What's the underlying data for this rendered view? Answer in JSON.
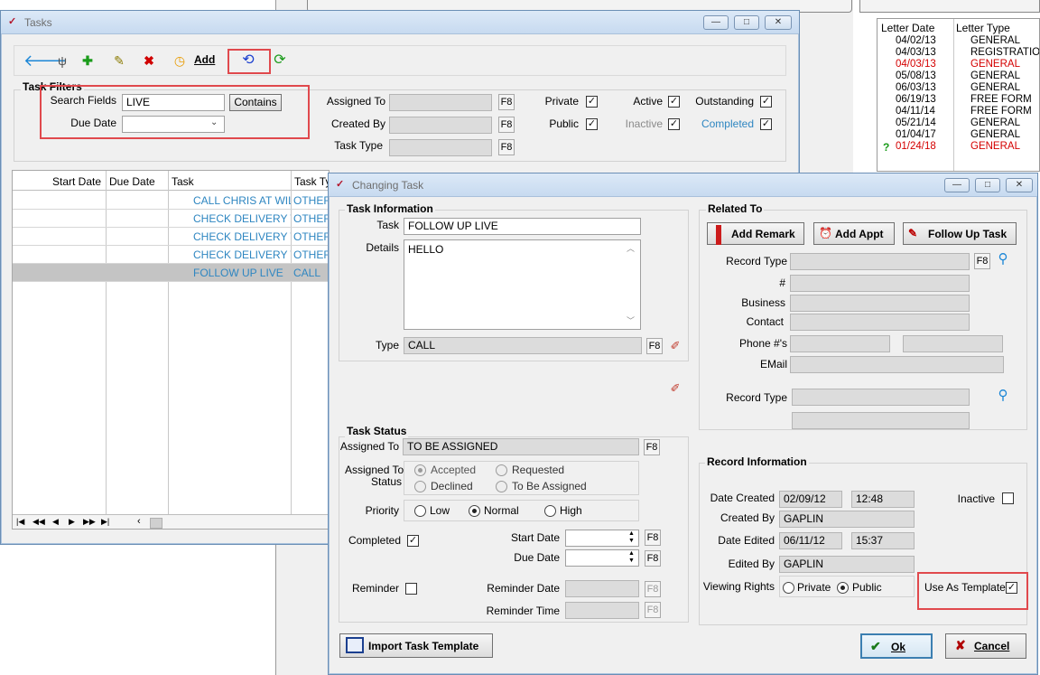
{
  "colors": {
    "accent": "#2e86c1",
    "highlight": "#e0494d",
    "overdue": "#d40000"
  },
  "bg": {
    "letter_headers": [
      "Letter Date",
      "Letter Type"
    ],
    "letters": [
      {
        "date": "04/02/13",
        "type": "GENERAL",
        "red": false
      },
      {
        "date": "04/03/13",
        "type": "REGISTRATION",
        "red": false
      },
      {
        "date": "04/03/13",
        "type": "GENERAL",
        "red": true
      },
      {
        "date": "05/08/13",
        "type": "GENERAL",
        "red": false
      },
      {
        "date": "06/03/13",
        "type": "GENERAL",
        "red": false
      },
      {
        "date": "06/19/13",
        "type": "FREE FORM",
        "red": false
      },
      {
        "date": "04/11/14",
        "type": "FREE FORM",
        "red": false
      },
      {
        "date": "05/21/14",
        "type": "GENERAL",
        "red": false
      },
      {
        "date": "01/04/17",
        "type": "GENERAL",
        "red": false
      },
      {
        "date": "01/24/18",
        "type": "GENERAL",
        "red": true
      }
    ]
  },
  "tasks": {
    "title": "Tasks",
    "toolbar": {
      "add_label": "Add"
    },
    "filters": {
      "group_title": "Task Filters",
      "search_fields_label": "Search Fields",
      "search_value": "LIVE",
      "contains_label": "Contains",
      "due_date_label": "Due Date",
      "assigned_to_label": "Assigned To",
      "created_by_label": "Created By",
      "task_type_label": "Task Type",
      "f8": "F8",
      "private_label": "Private",
      "public_label": "Public",
      "active_label": "Active",
      "inactive_label": "Inactive",
      "outstanding_label": "Outstanding",
      "completed_label": "Completed"
    },
    "grid": {
      "headers": [
        "Start Date",
        "Due Date",
        "Task",
        "Task Ty"
      ],
      "rows": [
        {
          "task": "CALL CHRIS AT WILL",
          "type": "OTHER"
        },
        {
          "task": "CHECK DELIVERY TI",
          "type": "OTHER"
        },
        {
          "task": "CHECK DELIVERY TI",
          "type": "OTHER"
        },
        {
          "task": "CHECK DELIVERY TI",
          "type": "OTHER"
        },
        {
          "task": "FOLLOW UP LIVE",
          "type": "CALL"
        }
      ]
    }
  },
  "changing": {
    "title": "Changing Task",
    "task_info": {
      "group_title": "Task Information",
      "task_label": "Task",
      "task_value": "FOLLOW UP LIVE",
      "details_label": "Details",
      "details_value": "HELLO",
      "type_label": "Type",
      "type_value": "CALL",
      "f8": "F8"
    },
    "status": {
      "group_title": "Task Status",
      "assigned_to_label": "Assigned To",
      "assigned_to_value": "TO BE ASSIGNED",
      "f8": "F8",
      "assigned_status_label_1": "Assigned To",
      "assigned_status_label_2": "Status",
      "accepted": "Accepted",
      "requested": "Requested",
      "declined": "Declined",
      "to_be_assigned": "To Be Assigned",
      "priority_label": "Priority",
      "low": "Low",
      "normal": "Normal",
      "high": "High",
      "completed_label": "Completed",
      "start_date_label": "Start Date",
      "due_date_label": "Due Date",
      "reminder_label": "Reminder",
      "reminder_date_label": "Reminder Date",
      "reminder_time_label": "Reminder Time"
    },
    "related": {
      "group_title": "Related To",
      "add_remark": "Add Remark",
      "add_appt": "Add Appt",
      "follow_up": "Follow Up Task",
      "record_type_label": "Record Type",
      "number_label": "#",
      "business_label": "Business",
      "contact_label": "Contact",
      "phone_label": "Phone #'s",
      "email_label": "EMail",
      "record_type2_label": "Record Type",
      "f8": "F8"
    },
    "record": {
      "group_title": "Record Information",
      "date_created_label": "Date Created",
      "date_created": "02/09/12",
      "time_created": "12:48",
      "created_by_label": "Created By",
      "created_by": "GAPLIN",
      "date_edited_label": "Date Edited",
      "date_edited": "06/11/12",
      "time_edited": "15:37",
      "edited_by_label": "Edited By",
      "edited_by": "GAPLIN",
      "inactive_label": "Inactive",
      "viewing_rights_label": "Viewing Rights",
      "private": "Private",
      "public": "Public",
      "use_as_template_label": "Use As Template"
    },
    "import_label": "Import Task Template",
    "ok_label": "Ok",
    "cancel_label": "Cancel"
  }
}
